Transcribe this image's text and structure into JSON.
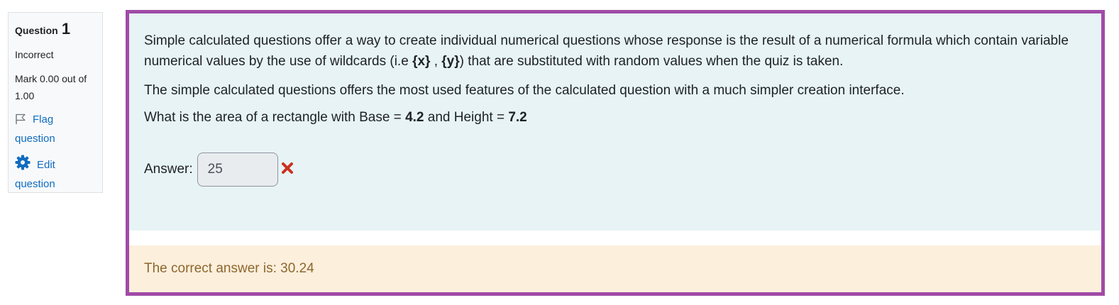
{
  "info": {
    "question_label": "Question",
    "question_number": "1",
    "state": "Incorrect",
    "grade": "Mark 0.00 out of 1.00",
    "flag_label_1": "Flag",
    "flag_label_2": "question",
    "edit_label_1": "Edit",
    "edit_label_2": "question",
    "link_color": "#0f6cbf"
  },
  "question": {
    "p1": {
      "text_a": "Simple calculated questions offer a way to create individual numerical questions whose response is the result of a numerical formula which contain variable numerical values by the use of wildcards (i.e ",
      "wild_x": "{x}",
      "sep": " , ",
      "wild_y": "{y}",
      "text_b": ") that are substituted with random values when the quiz is taken."
    },
    "p2": "The simple calculated questions offers the most used features of the calculated question with a much simpler creation interface.",
    "p3": {
      "text_a": "What is the area of a rectangle with Base = ",
      "base": "4.2",
      "text_b": " and Height = ",
      "height": "7.2"
    },
    "answer_label": "Answer:",
    "answer_value": "25",
    "incorrect_icon": "cross-icon",
    "border_color": "#a04ba6",
    "background_color": "#e7f3f5"
  },
  "feedback": {
    "right_answer": "The correct answer is: 30.24",
    "background_color": "#fcefdc",
    "text_color": "#8e662e"
  }
}
